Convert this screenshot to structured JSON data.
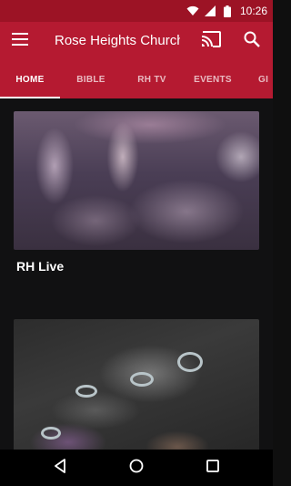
{
  "status_bar": {
    "time": "10:26",
    "icons": [
      "wifi-icon",
      "signal-icon",
      "battery-icon"
    ]
  },
  "app_bar": {
    "title": "Rose Heights Church",
    "menu_icon": "menu-icon",
    "cast_icon": "cast-icon",
    "search_icon": "search-icon"
  },
  "tabs": [
    {
      "label": "HOME",
      "active": true
    },
    {
      "label": "BIBLE",
      "active": false
    },
    {
      "label": "RH TV",
      "active": false
    },
    {
      "label": "EVENTS",
      "active": false
    },
    {
      "label": "GI",
      "active": false
    }
  ],
  "cards": [
    {
      "title": "RH Live"
    },
    {
      "title": ""
    }
  ],
  "nav_bar": {
    "back_icon": "back-icon",
    "home_icon": "home-icon",
    "recents_icon": "recents-icon"
  },
  "colors": {
    "status_bar": "#9c1325",
    "app_bar": "#b51a31",
    "background": "#111112",
    "nav_bar": "#000000"
  }
}
